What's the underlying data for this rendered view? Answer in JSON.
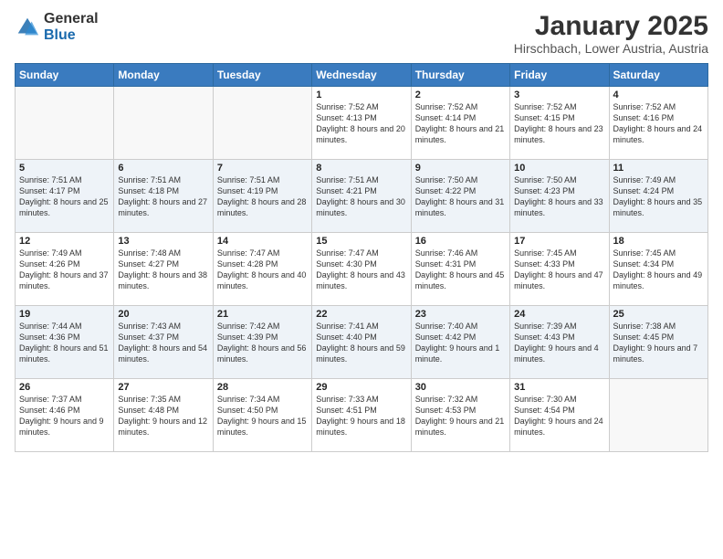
{
  "header": {
    "logo_general": "General",
    "logo_blue": "Blue",
    "month_title": "January 2025",
    "location": "Hirschbach, Lower Austria, Austria"
  },
  "weekdays": [
    "Sunday",
    "Monday",
    "Tuesday",
    "Wednesday",
    "Thursday",
    "Friday",
    "Saturday"
  ],
  "weeks": [
    [
      {
        "day": "",
        "sunrise": "",
        "sunset": "",
        "daylight": ""
      },
      {
        "day": "",
        "sunrise": "",
        "sunset": "",
        "daylight": ""
      },
      {
        "day": "",
        "sunrise": "",
        "sunset": "",
        "daylight": ""
      },
      {
        "day": "1",
        "sunrise": "Sunrise: 7:52 AM",
        "sunset": "Sunset: 4:13 PM",
        "daylight": "Daylight: 8 hours and 20 minutes."
      },
      {
        "day": "2",
        "sunrise": "Sunrise: 7:52 AM",
        "sunset": "Sunset: 4:14 PM",
        "daylight": "Daylight: 8 hours and 21 minutes."
      },
      {
        "day": "3",
        "sunrise": "Sunrise: 7:52 AM",
        "sunset": "Sunset: 4:15 PM",
        "daylight": "Daylight: 8 hours and 23 minutes."
      },
      {
        "day": "4",
        "sunrise": "Sunrise: 7:52 AM",
        "sunset": "Sunset: 4:16 PM",
        "daylight": "Daylight: 8 hours and 24 minutes."
      }
    ],
    [
      {
        "day": "5",
        "sunrise": "Sunrise: 7:51 AM",
        "sunset": "Sunset: 4:17 PM",
        "daylight": "Daylight: 8 hours and 25 minutes."
      },
      {
        "day": "6",
        "sunrise": "Sunrise: 7:51 AM",
        "sunset": "Sunset: 4:18 PM",
        "daylight": "Daylight: 8 hours and 27 minutes."
      },
      {
        "day": "7",
        "sunrise": "Sunrise: 7:51 AM",
        "sunset": "Sunset: 4:19 PM",
        "daylight": "Daylight: 8 hours and 28 minutes."
      },
      {
        "day": "8",
        "sunrise": "Sunrise: 7:51 AM",
        "sunset": "Sunset: 4:21 PM",
        "daylight": "Daylight: 8 hours and 30 minutes."
      },
      {
        "day": "9",
        "sunrise": "Sunrise: 7:50 AM",
        "sunset": "Sunset: 4:22 PM",
        "daylight": "Daylight: 8 hours and 31 minutes."
      },
      {
        "day": "10",
        "sunrise": "Sunrise: 7:50 AM",
        "sunset": "Sunset: 4:23 PM",
        "daylight": "Daylight: 8 hours and 33 minutes."
      },
      {
        "day": "11",
        "sunrise": "Sunrise: 7:49 AM",
        "sunset": "Sunset: 4:24 PM",
        "daylight": "Daylight: 8 hours and 35 minutes."
      }
    ],
    [
      {
        "day": "12",
        "sunrise": "Sunrise: 7:49 AM",
        "sunset": "Sunset: 4:26 PM",
        "daylight": "Daylight: 8 hours and 37 minutes."
      },
      {
        "day": "13",
        "sunrise": "Sunrise: 7:48 AM",
        "sunset": "Sunset: 4:27 PM",
        "daylight": "Daylight: 8 hours and 38 minutes."
      },
      {
        "day": "14",
        "sunrise": "Sunrise: 7:47 AM",
        "sunset": "Sunset: 4:28 PM",
        "daylight": "Daylight: 8 hours and 40 minutes."
      },
      {
        "day": "15",
        "sunrise": "Sunrise: 7:47 AM",
        "sunset": "Sunset: 4:30 PM",
        "daylight": "Daylight: 8 hours and 43 minutes."
      },
      {
        "day": "16",
        "sunrise": "Sunrise: 7:46 AM",
        "sunset": "Sunset: 4:31 PM",
        "daylight": "Daylight: 8 hours and 45 minutes."
      },
      {
        "day": "17",
        "sunrise": "Sunrise: 7:45 AM",
        "sunset": "Sunset: 4:33 PM",
        "daylight": "Daylight: 8 hours and 47 minutes."
      },
      {
        "day": "18",
        "sunrise": "Sunrise: 7:45 AM",
        "sunset": "Sunset: 4:34 PM",
        "daylight": "Daylight: 8 hours and 49 minutes."
      }
    ],
    [
      {
        "day": "19",
        "sunrise": "Sunrise: 7:44 AM",
        "sunset": "Sunset: 4:36 PM",
        "daylight": "Daylight: 8 hours and 51 minutes."
      },
      {
        "day": "20",
        "sunrise": "Sunrise: 7:43 AM",
        "sunset": "Sunset: 4:37 PM",
        "daylight": "Daylight: 8 hours and 54 minutes."
      },
      {
        "day": "21",
        "sunrise": "Sunrise: 7:42 AM",
        "sunset": "Sunset: 4:39 PM",
        "daylight": "Daylight: 8 hours and 56 minutes."
      },
      {
        "day": "22",
        "sunrise": "Sunrise: 7:41 AM",
        "sunset": "Sunset: 4:40 PM",
        "daylight": "Daylight: 8 hours and 59 minutes."
      },
      {
        "day": "23",
        "sunrise": "Sunrise: 7:40 AM",
        "sunset": "Sunset: 4:42 PM",
        "daylight": "Daylight: 9 hours and 1 minute."
      },
      {
        "day": "24",
        "sunrise": "Sunrise: 7:39 AM",
        "sunset": "Sunset: 4:43 PM",
        "daylight": "Daylight: 9 hours and 4 minutes."
      },
      {
        "day": "25",
        "sunrise": "Sunrise: 7:38 AM",
        "sunset": "Sunset: 4:45 PM",
        "daylight": "Daylight: 9 hours and 7 minutes."
      }
    ],
    [
      {
        "day": "26",
        "sunrise": "Sunrise: 7:37 AM",
        "sunset": "Sunset: 4:46 PM",
        "daylight": "Daylight: 9 hours and 9 minutes."
      },
      {
        "day": "27",
        "sunrise": "Sunrise: 7:35 AM",
        "sunset": "Sunset: 4:48 PM",
        "daylight": "Daylight: 9 hours and 12 minutes."
      },
      {
        "day": "28",
        "sunrise": "Sunrise: 7:34 AM",
        "sunset": "Sunset: 4:50 PM",
        "daylight": "Daylight: 9 hours and 15 minutes."
      },
      {
        "day": "29",
        "sunrise": "Sunrise: 7:33 AM",
        "sunset": "Sunset: 4:51 PM",
        "daylight": "Daylight: 9 hours and 18 minutes."
      },
      {
        "day": "30",
        "sunrise": "Sunrise: 7:32 AM",
        "sunset": "Sunset: 4:53 PM",
        "daylight": "Daylight: 9 hours and 21 minutes."
      },
      {
        "day": "31",
        "sunrise": "Sunrise: 7:30 AM",
        "sunset": "Sunset: 4:54 PM",
        "daylight": "Daylight: 9 hours and 24 minutes."
      },
      {
        "day": "",
        "sunrise": "",
        "sunset": "",
        "daylight": ""
      }
    ]
  ]
}
